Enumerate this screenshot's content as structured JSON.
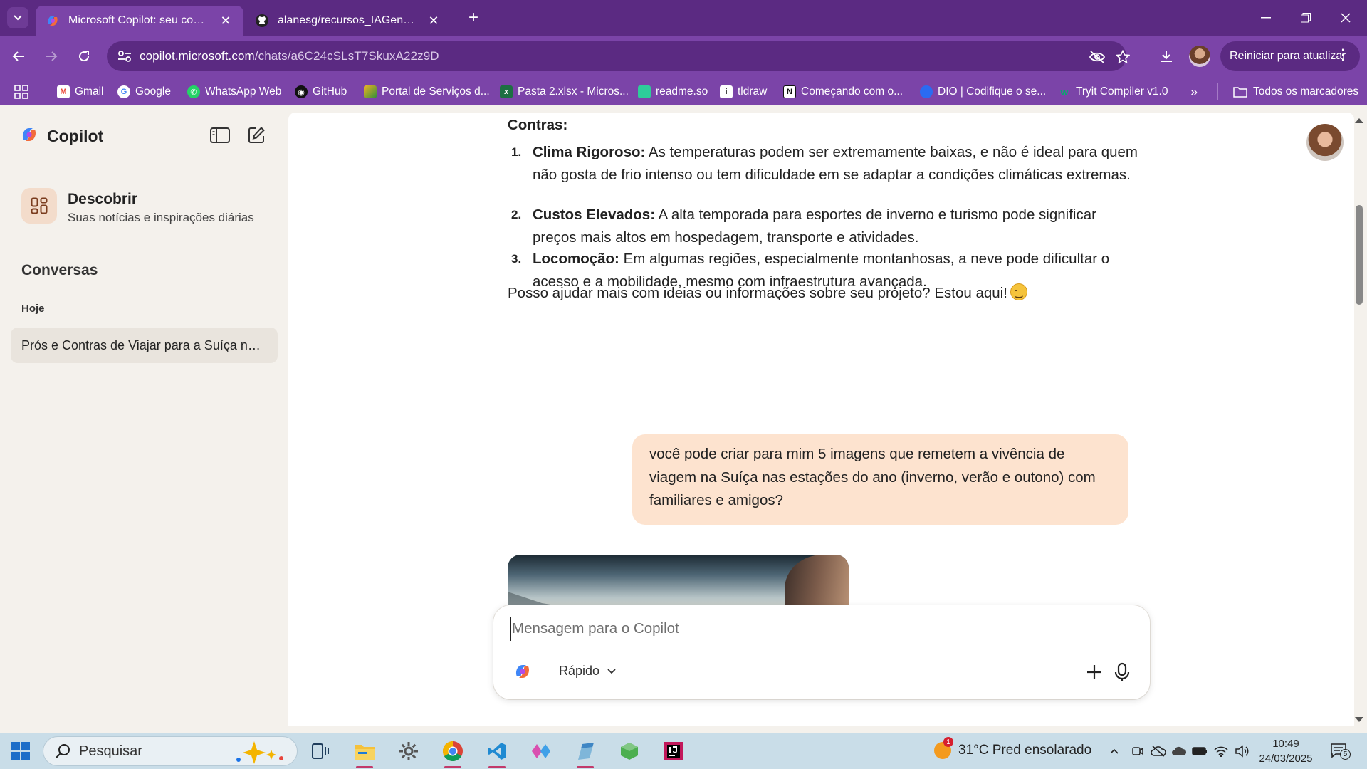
{
  "browser": {
    "tabs": [
      {
        "title": "Microsoft Copilot: seu companheiro de IA",
        "active": true
      },
      {
        "title": "alanesg/recursos_IAGenerativa",
        "active": false
      }
    ],
    "url_host": "copilot.microsoft.com",
    "url_path": "/chats/a6C24cSLsT7SkuxA22z9D",
    "update_button": "Reiniciar para atualizar",
    "bookmarks": [
      {
        "label": "Gmail",
        "icon": "gmail-icon",
        "color": "#ea4335"
      },
      {
        "label": "Google",
        "icon": "google-icon",
        "color": "#4285f4"
      },
      {
        "label": "WhatsApp Web",
        "icon": "whatsapp-icon",
        "color": "#25d366"
      },
      {
        "label": "GitHub",
        "icon": "github-icon",
        "color": "#111111"
      },
      {
        "label": "Portal de Serviços d...",
        "icon": "portal-icon",
        "color": "#f0b323"
      },
      {
        "label": "Pasta 2.xlsx - Micros...",
        "icon": "excel-icon",
        "color": "#1d6f42"
      },
      {
        "label": "readme.so",
        "icon": "readme-icon",
        "color": "#2ecc9a"
      },
      {
        "label": "tldraw",
        "icon": "tldraw-icon",
        "color": "#ffffff"
      },
      {
        "label": "Começando com o...",
        "icon": "notion-icon",
        "color": "#ffffff"
      },
      {
        "label": "DIO | Codifique o se...",
        "icon": "dio-icon",
        "color": "#2a6bf2"
      },
      {
        "label": "Tryit Compiler v1.0",
        "icon": "w3-icon",
        "color": "#04aa6d"
      }
    ],
    "all_bookmarks": "Todos os marcadores"
  },
  "sidebar": {
    "brand": "Copilot",
    "discover_title": "Descobrir",
    "discover_subtitle": "Suas notícias e inspirações diárias",
    "conversations_heading": "Conversas",
    "today_label": "Hoje",
    "conversation_item": "Prós e Contras de Viajar para a Suíça nas estações do ano"
  },
  "chat": {
    "cons_heading": "Contras:",
    "cons": [
      {
        "num": "1.",
        "title": "Clima Rigoroso:",
        "text": " As temperaturas podem ser extremamente baixas, e não é ideal para quem não gosta de frio intenso ou tem dificuldade em se adaptar a condições climáticas extremas."
      },
      {
        "num": "2.",
        "title": "Custos Elevados:",
        "text": " A alta temporada para esportes de inverno e turismo pode significar preços mais altos em hospedagem, transporte e atividades."
      },
      {
        "num": "3.",
        "title": "Locomoção:",
        "text": " Em algumas regiões, especialmente montanhosas, a neve pode dificultar o acesso e a mobilidade, mesmo com infraestrutura avançada."
      }
    ],
    "closing": "Posso ajudar mais com ideias ou informações sobre seu projeto? Estou aqui!",
    "user_message": "você pode criar para mim  5 imagens que remetem a vivência de viagem na Suíça nas estações do ano (inverno, verão e outono) com familiares e amigos?",
    "composer_placeholder": "Mensagem para o Copilot",
    "mode_label": "Rápido"
  },
  "taskbar": {
    "search_placeholder": "Pesquisar",
    "weather": "31°C  Pred ensolarado",
    "weather_badge": "1",
    "time": "10:49",
    "date": "24/03/2025",
    "notification_count": "5"
  }
}
